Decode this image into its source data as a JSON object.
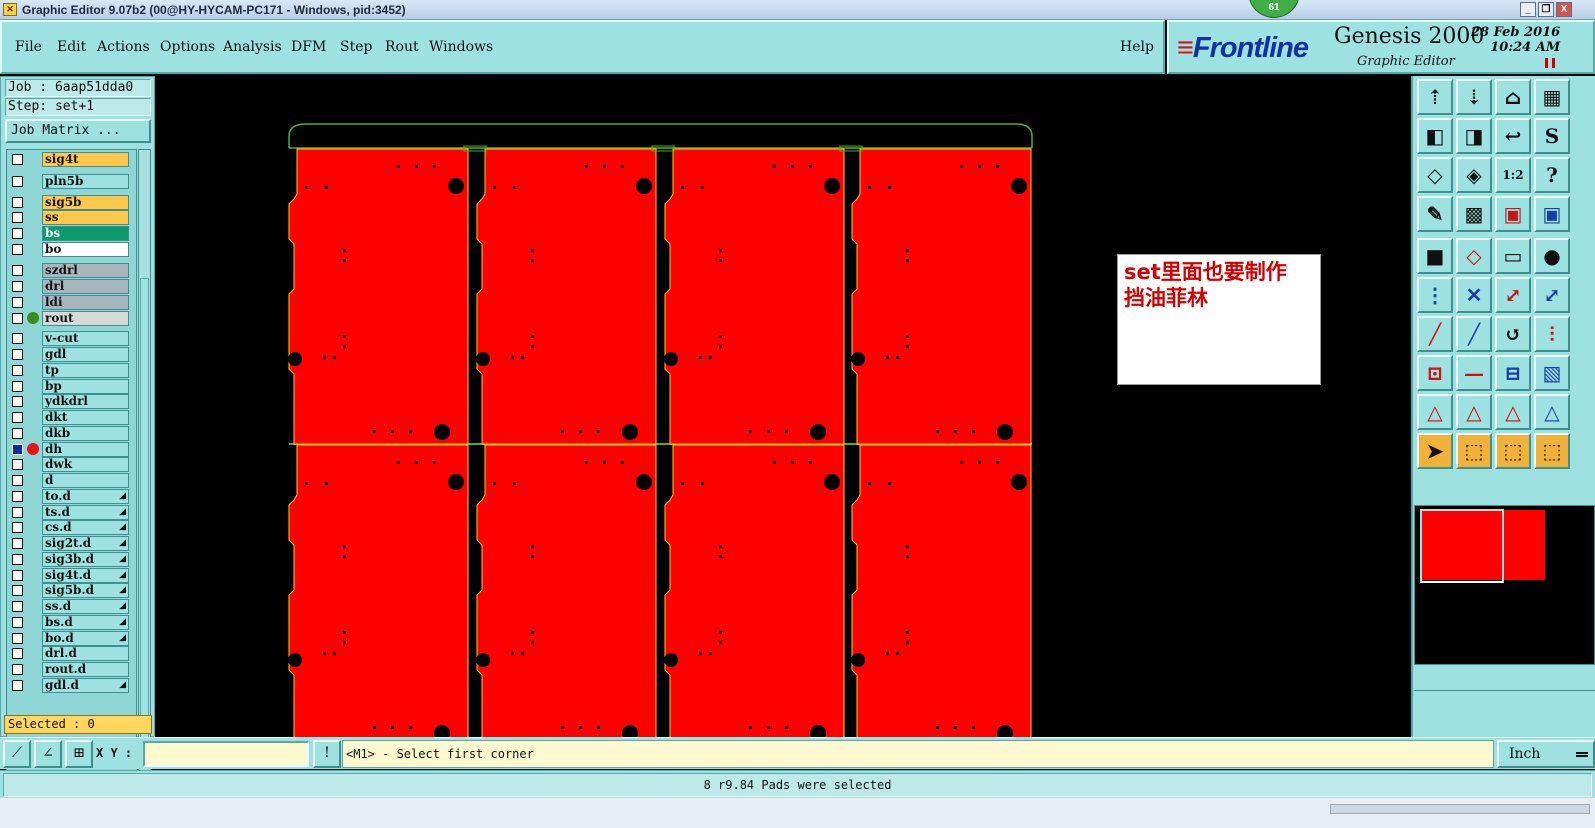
{
  "window": {
    "title": "Graphic Editor 9.07b2 (00@HY-HYCAM-PC171 - Windows, pid:3452)",
    "badge": "61",
    "min_label": "_",
    "restore_label": "❐",
    "close_label": "X"
  },
  "menu": {
    "items": [
      "File",
      "Edit",
      "Actions",
      "Options",
      "Analysis",
      "DFM",
      "Step",
      "Rout",
      "Windows"
    ],
    "help": "Help"
  },
  "brand": {
    "logo": "Frontline",
    "product": "Genesis 2000",
    "subtitle": "Graphic Editor",
    "date": "28 Feb 2016",
    "time": "10:24 AM",
    "colors": {
      "logo_blue": "#1232a0",
      "logo_red": "#d4141b"
    }
  },
  "left_panel": {
    "job": "Job : 6aap51dda0",
    "step": "Step: set+1",
    "job_matrix": "Job Matrix ...",
    "selected": "Selected : 0",
    "layers": [
      {
        "name": "sig4t",
        "color": "#ffc84a",
        "marker": ""
      },
      {
        "name": "pln5b",
        "color": "#9ee1e1",
        "marker": ""
      },
      {
        "name": "sig5b",
        "color": "#ffc84a",
        "marker": ""
      },
      {
        "name": "ss",
        "color": "#ffc84a",
        "marker": ""
      },
      {
        "name": "bs",
        "color": "#0f9a6b",
        "marker": ""
      },
      {
        "name": "bo",
        "color": "#ffffff",
        "marker": ""
      },
      {
        "name": "szdrl",
        "color": "#a9b6bf",
        "marker": ""
      },
      {
        "name": "drl",
        "color": "#a9b6bf",
        "marker": ""
      },
      {
        "name": "ldi",
        "color": "#a9b6bf",
        "marker": ""
      },
      {
        "name": "rout",
        "color": "#d9d9d9",
        "marker": "green"
      },
      {
        "name": "v-cut",
        "color": "#9ee1e1",
        "marker": ""
      },
      {
        "name": "gdl",
        "color": "#9ee1e1",
        "marker": ""
      },
      {
        "name": "tp",
        "color": "#9ee1e1",
        "marker": ""
      },
      {
        "name": "bp",
        "color": "#9ee1e1",
        "marker": ""
      },
      {
        "name": "ydkdrl",
        "color": "#9ee1e1",
        "marker": ""
      },
      {
        "name": "dkt",
        "color": "#9ee1e1",
        "marker": ""
      },
      {
        "name": "dkb",
        "color": "#9ee1e1",
        "marker": ""
      },
      {
        "name": "dh",
        "color": "#9ee1e1",
        "marker": "red",
        "selected": true
      },
      {
        "name": "dwk",
        "color": "#9ee1e1",
        "marker": ""
      },
      {
        "name": "d",
        "color": "#9ee1e1",
        "marker": ""
      },
      {
        "name": "to.d",
        "color": "#9ee1e1",
        "marker": "",
        "flag": true
      },
      {
        "name": "ts.d",
        "color": "#9ee1e1",
        "marker": "",
        "flag": true
      },
      {
        "name": "cs.d",
        "color": "#9ee1e1",
        "marker": "",
        "flag": true
      },
      {
        "name": "sig2t.d",
        "color": "#9ee1e1",
        "marker": "",
        "flag": true
      },
      {
        "name": "sig3b.d",
        "color": "#9ee1e1",
        "marker": "",
        "flag": true
      },
      {
        "name": "sig4t.d",
        "color": "#9ee1e1",
        "marker": "",
        "flag": true
      },
      {
        "name": "sig5b.d",
        "color": "#9ee1e1",
        "marker": "",
        "flag": true
      },
      {
        "name": "ss.d",
        "color": "#9ee1e1",
        "marker": "",
        "flag": true
      },
      {
        "name": "bs.d",
        "color": "#9ee1e1",
        "marker": "",
        "flag": true
      },
      {
        "name": "bo.d",
        "color": "#9ee1e1",
        "marker": "",
        "flag": true
      },
      {
        "name": "drl.d",
        "color": "#9ee1e1",
        "marker": ""
      },
      {
        "name": "rout.d",
        "color": "#9ee1e1",
        "marker": ""
      },
      {
        "name": "gdl.d",
        "color": "#9ee1e1",
        "marker": "",
        "flag": true
      }
    ]
  },
  "canvas": {
    "note": [
      "set里面也要制作",
      "挡油菲林"
    ],
    "board_color": "#ff0000",
    "outline_color": "#ffd000",
    "border_color": "#4caf2a"
  },
  "tools": [
    {
      "name": "zoom-home-icon"
    },
    {
      "name": "zoom-in-icon"
    },
    {
      "name": "home-icon"
    },
    {
      "name": "window-fit-icon"
    },
    {
      "name": "pan-left-icon"
    },
    {
      "name": "pan-right-icon"
    },
    {
      "name": "undo-zoom-icon"
    },
    {
      "name": "snap-icon"
    },
    {
      "name": "fit-all-icon"
    },
    {
      "name": "fit-profile-icon"
    },
    {
      "name": "scale-1to2-icon"
    },
    {
      "name": "query-icon"
    },
    {
      "name": "measure-icon"
    },
    {
      "name": "grid-icon"
    },
    {
      "name": "layers-red-icon"
    },
    {
      "name": "layers-blue-icon"
    },
    {
      "name": "pad-icon"
    },
    {
      "name": "polygon-icon"
    },
    {
      "name": "ruler-icon"
    },
    {
      "name": "dot-icon"
    },
    {
      "name": "net-icon"
    },
    {
      "name": "cross-icon"
    },
    {
      "name": "line-red-icon"
    },
    {
      "name": "line-blue-icon"
    },
    {
      "name": "slash-red-icon"
    },
    {
      "name": "slash-blue-icon"
    },
    {
      "name": "arc-icon"
    },
    {
      "name": "bracket-icon"
    },
    {
      "name": "connect-icon"
    },
    {
      "name": "dash-icon"
    },
    {
      "name": "align-icon"
    },
    {
      "name": "boxes-icon"
    },
    {
      "name": "triangle-red-icon"
    },
    {
      "name": "triangle-a-icon"
    },
    {
      "name": "triangle-blue-icon"
    },
    {
      "name": "triangle-wide-icon"
    },
    {
      "name": "select-pointer-icon"
    },
    {
      "name": "select-box-icon"
    },
    {
      "name": "select-arrow-icon"
    },
    {
      "name": "select-route-icon"
    }
  ],
  "bottom": {
    "xy_label": "X Y :",
    "xy_value": "",
    "bang": "!",
    "prompt": "<M1> - Select first corner",
    "units": "Inch"
  },
  "status": "8 r9.84 Pads were selected"
}
